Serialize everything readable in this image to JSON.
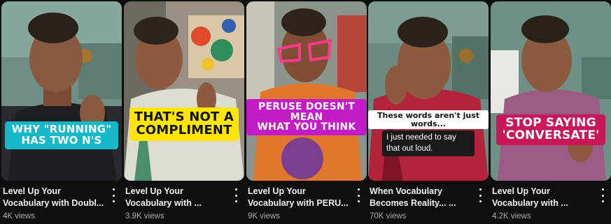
{
  "videos": [
    {
      "caption": [
        "Why \"Running\"",
        "has two N's"
      ],
      "title": [
        "Level Up Your",
        "Vocabulary with Doubl..."
      ],
      "views": "4K views",
      "more_icon": "more-vert-icon"
    },
    {
      "caption": [
        "That's not a",
        "compliment"
      ],
      "title": [
        "Level Up Your",
        "Vocabulary with ..."
      ],
      "views": "3.9K views",
      "more_icon": "more-vert-icon"
    },
    {
      "caption": [
        "Peruse doesn't mean",
        "what you think"
      ],
      "title": [
        "Level Up Your",
        "Vocabulary with PERU..."
      ],
      "views": "9K views",
      "more_icon": "more-vert-icon"
    },
    {
      "caption": [
        "These words aren't just words...",
        "I just needed to say that out loud."
      ],
      "title": [
        "When Vocabulary",
        "Becomes Reality... ..."
      ],
      "views": "70K views",
      "more_icon": "more-vert-icon"
    },
    {
      "caption": [
        "Stop saying",
        "'conversate'"
      ],
      "title": [
        "Level Up Your",
        "Vocabulary with ..."
      ],
      "views": "4.2K views",
      "more_icon": "more-vert-icon"
    }
  ],
  "colors": {
    "background": "#0f0f0f",
    "caption_teal": "#14b8c9",
    "caption_yellow": "#ffe600",
    "caption_purple": "#c21cc6",
    "caption_pink": "#c8185a"
  }
}
